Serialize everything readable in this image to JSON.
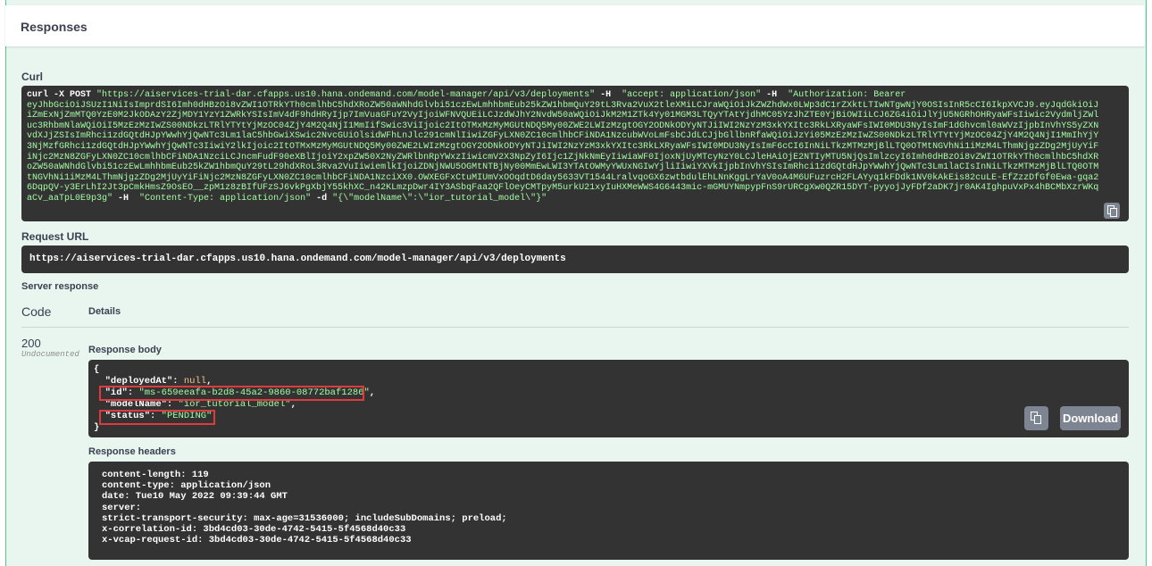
{
  "section_title": "Responses",
  "curl": {
    "label": "Curl",
    "cmd_prefix": "curl -X POST ",
    "url_str": "\"https://aiservices-trial-dar.cfapps.us10.hana.ondemand.com/model-manager/api/v3/deployments\"",
    "h1_flag": " -H  ",
    "h1_val": "\"accept: application/json\"",
    "h2_flag": " -H  ",
    "h2_open": "\"Authorization: Bearer",
    "token": "eyJhbGciOiJSUzI1NiIsImprdSI6Imh0dHBzOi8vZWI1OTRkYTh0cmlhbC5hdXRoZW50aWNhdGlvbi51czEwLmhhbmEub25kZW1hbmQuY29tL3Rva2VuX2tleXMiLCJraWQiOiJkZWZhdWx0LWp3dC1rZXktLTIwNTgwNjY0OSIsInR5cCI6IkpXVCJ9.eyJqdGkiOiJiZmExNjZmMTQ0YzE0M2JkODAzY2ZjMDY1YzY1ZWRkYSIsImV4dF9hdHRyIjp7ImVuaGFuY2VyIjoiWFNVQUEiLCJzdWJhY2NvdW50aWQiOiJkM2M1ZTk4Yy01MGM3LTQyYTAtYjdhMC05YzJhZTE0YjBiOWIiLCJ6ZG4iOiJlYjU5NGRhOHRyaWFsIiwic2VydmljZWluc3RhbmNlaWQiOiI5MzEzMzIwZS00NDkzLTRlYTYtYjMzOC04ZjY4M2Q4NjI1MmIifSwic3ViIjoic2ItOTMxMzMyMGUtNDQ5My00ZWE2LWIzMzgtOGY2ODNkODYyNTJiIWI2NzYzM3xkYXItc3RkLXRyaWFsIWI0MDU3NyIsImF1dGhvcml0aWVzIjpbInVhYS5yZXNvdXJjZSIsImRhci1zdGQtdHJpYWwhYjQwNTc3Lm1laC5hbGwiXSwic2NvcGUiOlsidWFhLnJlc291cmNlIiwiZGFyLXN0ZC10cmlhbCFiNDA1NzcubWVoLmFsbCJdLCJjbGllbnRfaWQiOiJzYi05MzEzMzIwZS00NDkzLTRlYTYtYjMzOC04ZjY4M2Q4NjI1MmIhYjY3NjMzfGRhci1zdGQtdHJpYWwhYjQwNTc3IiwiY2lkIjoic2ItOTMxMzMyMGUtNDQ5My00ZWE2LWIzMzgtOGY2ODNkODYyNTJiIWI2NzYzM3xkYXItc3RkLXRyaWFsIWI0MDU3NyIsImF6cCI6InNiLTkzMTMzMjBlLTQ0OTMtNGVhNi1iMzM4LThmNjgzZDg2MjUyYiFiNjc2MzN8ZGFyLXN0ZC10cmlhbCFiNDA1NzciLCJncmFudF90eXBlIjoiY2xpZW50X2NyZWRlbnRpYWxzIiwicmV2X3NpZyI6Ijc1ZjNkNmEyIiwiaWF0IjoxNjUyMTcyNzY0LCJleHAiOjE2NTIyMTU5NjQsImlzcyI6Imh0dHBzOi8vZWI1OTRkYTh0cmlhbC5hdXRoZW50aWNhdGlvbi51czEwLmhhbmEub25kZW1hbmQuY29tL29hdXRoL3Rva2VuIiwiemlkIjoiZDNjNWU5OGMtNTBjNy00MmEwLWI3YTAtOWMyYWUxNGIwYjliIiwiYXVkIjpbInVhYSIsImRhci1zdGQtdHJpYWwhYjQwNTc3Lm1laCIsInNiLTkzMTMzMjBlLTQ0OTMtNGVhNi1iMzM4LThmNjgzZDg2MjUyYiFiNjc2MzN8ZGFyLXN0ZC10cmlhbCFiNDA1NzciXX0.OWXEGFxCtuMIUmVxOOqdtD6day5633VT1544LralvqoGX6zwtbdulEhLNnKggLrYaV0oA4M6UFuzrcH2FLAYyq1kFDdk1NV0kAkEis82cuLE-EfZzzDfGf0Ewa-gqa26DqpQV-y3ErLhI2Jt3pCmkHmsZ9OsEO__zpM1z8zBIfUFzSJ6vkPgXbjY55khXC_n42KLmzpDwr4IY3ASbqFaa2QFlOeyCMTpyM5urkU21xyIuHXMeWWS4G6443mic-mGMUYNmpypFnS9rURCgXw0QZR15DYT-pyyojJyFDf2aDK7jr0AK4IghpuVxPx4hBCMbXzrWKqaCv_aaTpL0E9p3g",
    "h2_close": "\"",
    "h3_flag": " -H  ",
    "h3_val": "\"Content-Type: application/json\"",
    "d_flag": " -d ",
    "d_val": "\"{\\\"modelName\\\":\\\"ior_tutorial_model\\\"}\""
  },
  "request_url": {
    "label": "Request URL",
    "value": "https://aiservices-trial-dar.cfapps.us10.hana.ondemand.com/model-manager/api/v3/deployments"
  },
  "server_response": {
    "label": "Server response",
    "col_code": "Code",
    "col_details": "Details",
    "code": "200",
    "code_note": "Undocumented",
    "body_label": "Response body",
    "body": {
      "open": "{",
      "deployedAt_key": "\"deployedAt\"",
      "deployedAt_val": "null",
      "id_key": "\"id\"",
      "id_val": "\"ms-659eeafa-b2d8-45a2-9860-08772baf1286\"",
      "modelName_key": "\"modelName\"",
      "modelName_val": "\"ior_tutorial_model\"",
      "status_key": "\"status\"",
      "status_val": "\"PENDING\"",
      "close": "}",
      "colon": ": ",
      "comma": ","
    },
    "download_label": "Download",
    "headers_label": "Response headers",
    "headers": [
      "content-length: 119",
      "content-type: application/json",
      "date: Tue10 May 2022 09:39:44 GMT",
      "server:",
      "strict-transport-security: max-age=31536000; includeSubDomains; preload;",
      "x-correlation-id: 3bd4cd03-30de-4742-5415-5f4568d40c33",
      "x-vcap-request-id: 3bd4cd03-30de-4742-5415-5f4568d40c33"
    ]
  },
  "colors": {
    "background": "#e9f5ef",
    "accent": "#49cc90",
    "code_bg": "#333333",
    "string": "#a2fca2",
    "null": "#fcc28c",
    "highlight": "#e0393e"
  }
}
